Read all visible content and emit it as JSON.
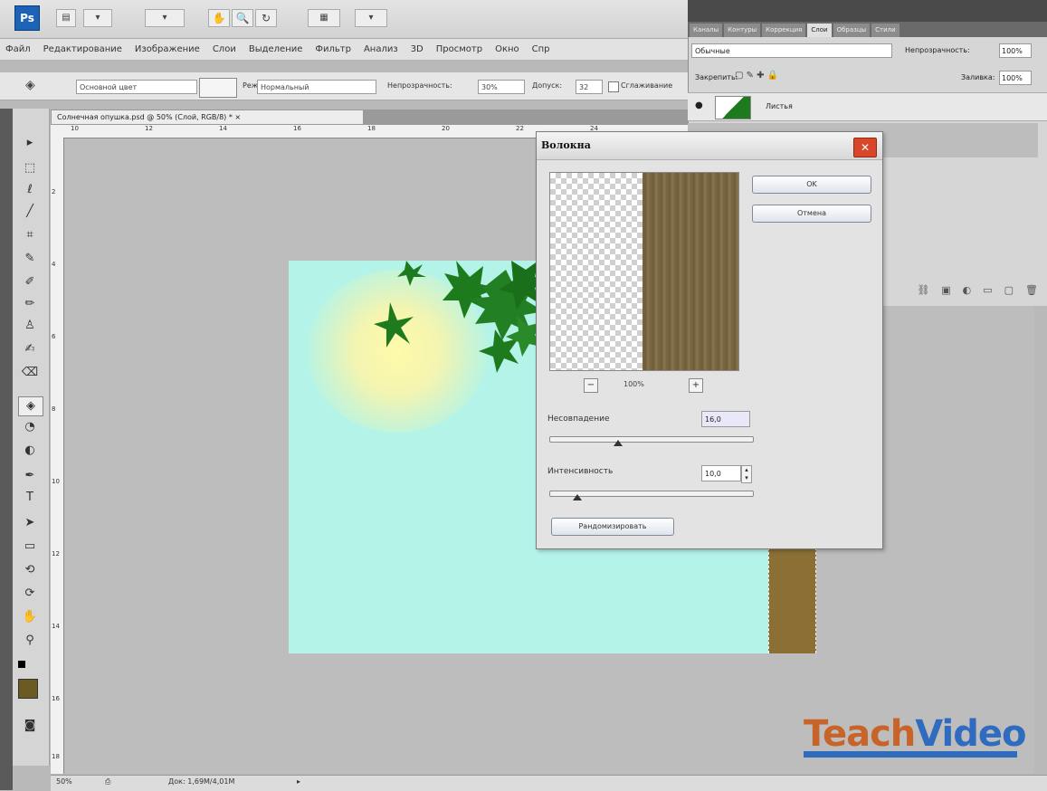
{
  "app": {
    "logo": "Ps",
    "app_buttons": [
      "▾",
      "▾",
      "▾"
    ]
  },
  "menu": [
    "Файл",
    "Редактирование",
    "Изображение",
    "Слои",
    "Выделение",
    "Фильтр",
    "Анализ",
    "3D",
    "Просмотр",
    "Окно",
    "Спр"
  ],
  "options_bar": {
    "preset": "Основной цвет",
    "mode_label": "Режим:",
    "mode_value": "Нормальный",
    "opacity_label": "Непрозрачность:",
    "opacity_value": "30%",
    "tolerance_label": "Допуск:",
    "tolerance_value": "32",
    "smoothing_label": "Сглаживание"
  },
  "document": {
    "tab_title": "Солнечная опушка.psd @ 50% (Слой, RGB/8) * ×",
    "ruler_top": [
      "10",
      "12",
      "14",
      "16",
      "18",
      "20",
      "22",
      "24"
    ],
    "ruler_left": [
      "2",
      "4",
      "6",
      "8",
      "10",
      "12",
      "14",
      "16",
      "18"
    ]
  },
  "layers_panel": {
    "tabs": [
      "Каналы",
      "Контуры",
      "Коррекция",
      "Слои",
      "Образцы",
      "Стили"
    ],
    "active_tab": "Слои",
    "blend_mode": "Обычные",
    "opacity_label": "Непрозрачность:",
    "opacity_value": "100%",
    "lock_label": "Закрепить:",
    "fill_label": "Заливка:",
    "fill_value": "100%",
    "layer_name": "Листья"
  },
  "dialog": {
    "title": "Волокна",
    "ok": "OK",
    "cancel": "Отмена",
    "zoom": "100%",
    "variance_label": "Несовпадение",
    "variance_value": "16,0",
    "strength_label": "Интенсивность",
    "strength_value": "10,0",
    "randomize": "Рандомизировать",
    "variance_fraction": 0.34,
    "strength_fraction": 0.14
  },
  "status_bar": {
    "zoom": "50%",
    "doc_info": "Док: 1,69M/4,01M"
  },
  "watermark": {
    "part1": "Teach",
    "part2": "Video"
  },
  "colors": {
    "canvas_sky": "#b3f3e8",
    "bark": "#8b6f35",
    "leaf": "#1d7a1d",
    "foreground_swatch": "#6b5a22"
  }
}
